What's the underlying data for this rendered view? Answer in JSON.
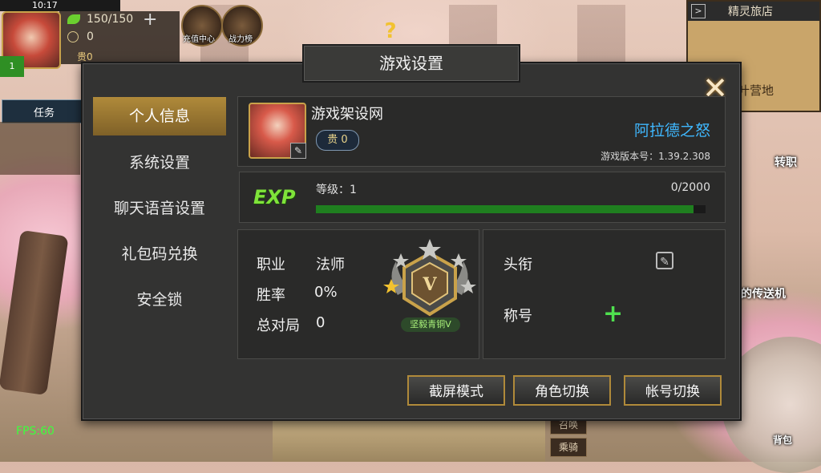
{
  "status_bar": {
    "time": "10:17"
  },
  "hud": {
    "level": "1",
    "energy": "150/150",
    "coins": "0",
    "vip": "贵0",
    "buttons": [
      {
        "label": "充值中心",
        "icon": "recharge-icon"
      },
      {
        "label": "战力榜",
        "icon": "power-ranking-icon"
      }
    ]
  },
  "minimap": {
    "title": "精灵旅店",
    "place": "叶营地"
  },
  "task": {
    "label": "任务"
  },
  "side": {
    "transfer": "转职",
    "teleport": "的传送机",
    "bag": "背包",
    "summon": "召唤",
    "mount": "乘骑"
  },
  "fps": "FPS:60",
  "dialog": {
    "title": "游戏设置",
    "menu": [
      {
        "label": "个人信息",
        "active": true
      },
      {
        "label": "系统设置",
        "active": false
      },
      {
        "label": "聊天语音设置",
        "active": false
      },
      {
        "label": "礼包码兑换",
        "active": false
      },
      {
        "label": "安全锁",
        "active": false
      }
    ],
    "profile": {
      "name": "游戏架设网",
      "vip": "贵 0",
      "server": "阿拉德之怒",
      "version": "游戏版本号：1.39.2.308"
    },
    "exp": {
      "logo": "EXP",
      "level_text": "等级：1",
      "count": "0/2000",
      "fraction": 0.97
    },
    "stats": {
      "class_label": "职业",
      "class_value": "法师",
      "winrate_label": "胜率",
      "winrate_value": "0%",
      "total_label": "总对局",
      "total_value": "0",
      "rank_caption": "坚毅青铜V",
      "rank_numeral": "V"
    },
    "titles": {
      "title_label": "头衔",
      "nickname_label": "称号"
    },
    "buttons": {
      "screenshot": "截屏模式",
      "switch_role": "角色切换",
      "switch_account": "帐号切换"
    }
  }
}
